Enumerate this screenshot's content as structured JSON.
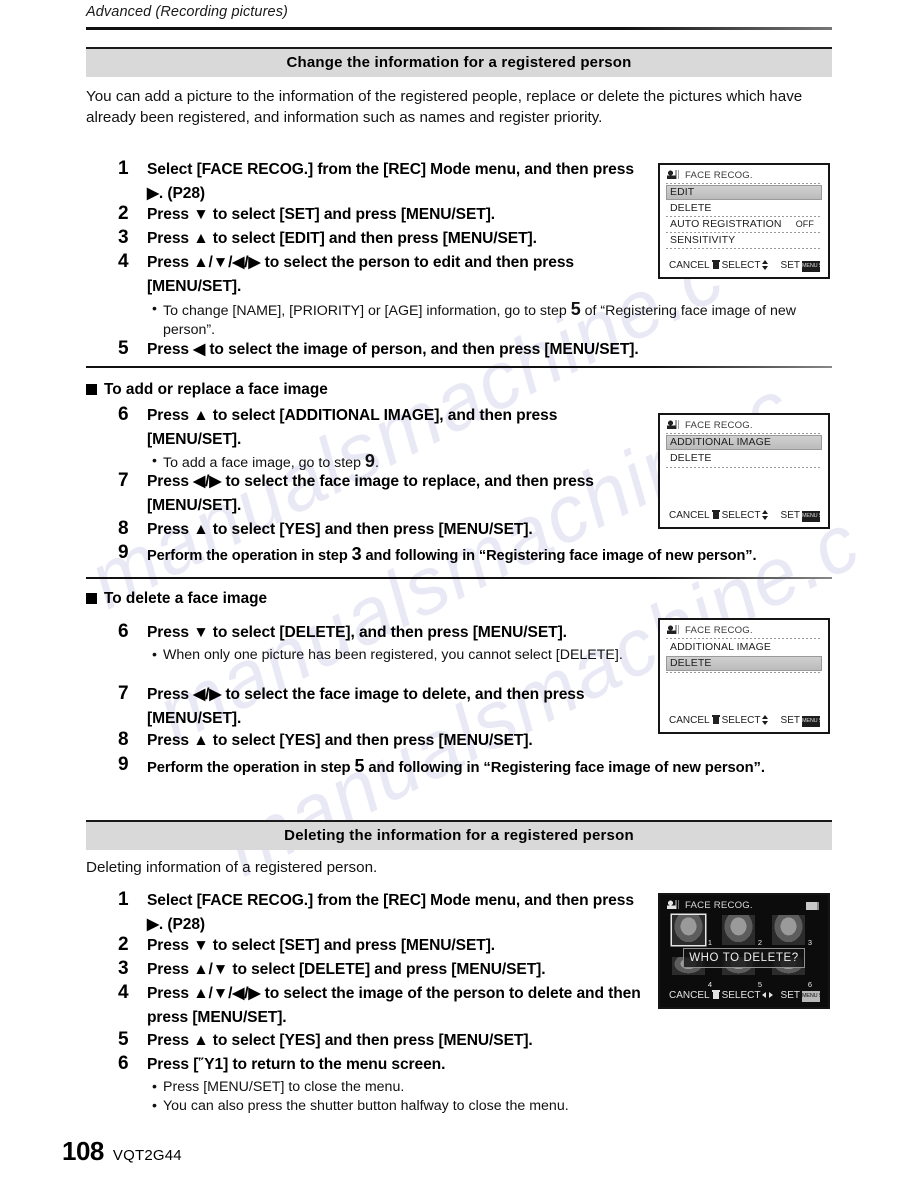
{
  "running_header": "Advanced (Recording pictures)",
  "watermark": "manualsmachine.com",
  "footer": {
    "page_number": "108",
    "doc_code": "VQT2G44"
  },
  "section1": {
    "banner_title": "Change the information for a registered person",
    "intro": "You can add a picture to the information of the registered people, replace or delete the pictures which have already been registered, and information such as names and register priority.",
    "steps": [
      {
        "num": "1",
        "text": "Select [FACE RECOG.] from the [REC] Mode menu, and then press ▶. (P28)"
      },
      {
        "num": "2",
        "text": "Press ▼ to select [SET] and press [MENU/SET]."
      },
      {
        "num": "3",
        "text": "Press ▲ to select [EDIT] and then press [MENU/SET]."
      },
      {
        "num": "4",
        "text": "Press ▲/▼/◀/▶ to select the person to edit and then press [MENU/SET]."
      }
    ],
    "bullet_after_4_a": "To change [NAME], [PRIORITY] or [AGE] information, go to step",
    "bullet_after_4_num": "5",
    "bullet_after_4_b": "of “Registering face image of new person”.",
    "step5": {
      "num": "5",
      "text": "Press ◀ to select the image of person, and then press [MENU/SET]."
    }
  },
  "subsection_add": {
    "heading": "To add or replace a face image",
    "step6": {
      "num": "6",
      "text": "Press ▲ to select [ADDITIONAL IMAGE], and then press [MENU/SET]."
    },
    "bullet6_a": "To add a face image, go to step",
    "bullet6_num": "9",
    "bullet6_b": ".",
    "step7": {
      "num": "7",
      "text": "Press ◀/▶ to select the face image to replace, and then press [MENU/SET]."
    },
    "step8": {
      "num": "8",
      "text": "Press ▲ to select [YES] and then press [MENU/SET]."
    },
    "step9": {
      "num": "9",
      "a": "Perform the operation in step",
      "step_ref": "3",
      "b": "and following in “Registering face image of new person”."
    }
  },
  "subsection_delete": {
    "heading": "To delete a face image",
    "step6": {
      "num": "6",
      "text": "Press ▼ to select [DELETE], and then press [MENU/SET]."
    },
    "bullet6": "When only one picture has been registered, you cannot select [DELETE].",
    "step7": {
      "num": "7",
      "text": "Press ◀/▶ to select the face image to delete, and then press [MENU/SET]."
    },
    "step8": {
      "num": "8",
      "text": "Press ▲ to select [YES] and then press [MENU/SET]."
    },
    "step9": {
      "num": "9",
      "a": "Perform the operation in step",
      "step_ref": "5",
      "b": "and following in “Registering face image of new person”."
    }
  },
  "section2": {
    "banner_title": "Deleting the information for a registered person",
    "intro": "Deleting information of a registered person.",
    "steps": [
      {
        "num": "1",
        "text": "Select [FACE RECOG.] from the [REC] Mode menu, and then press ▶. (P28)"
      },
      {
        "num": "2",
        "text": "Press ▼ to select [SET] and press [MENU/SET]."
      },
      {
        "num": "3",
        "text": "Press ▲/▼ to select [DELETE] and press [MENU/SET]."
      },
      {
        "num": "4",
        "text": "Press ▲/▼/◀/▶ to select the image of the person to delete and then press [MENU/SET]."
      },
      {
        "num": "5",
        "text": "Press ▲ to select [YES] and then press [MENU/SET]."
      },
      {
        "num": "6",
        "text": "Press [Ὕ1] to return to the menu screen."
      }
    ],
    "bullets": [
      "Press [MENU/SET] to close the menu.",
      "You can also press the shutter button halfway to close the menu."
    ]
  },
  "lcd1": {
    "title": "FACE RECOG.",
    "rows": [
      {
        "label": "EDIT",
        "value": "",
        "selected": true
      },
      {
        "label": "DELETE",
        "value": "",
        "selected": false
      },
      {
        "label": "AUTO REGISTRATION",
        "value": "OFF",
        "selected": false
      },
      {
        "label": "SENSITIVITY",
        "value": "",
        "selected": false
      }
    ],
    "cancel_label": "CANCEL",
    "select_label": "SELECT",
    "set_label": "SET",
    "set_button": "MENU SET"
  },
  "lcd2": {
    "title": "FACE RECOG.",
    "rows": [
      {
        "label": "ADDITIONAL IMAGE",
        "value": "",
        "selected": true
      },
      {
        "label": "DELETE",
        "value": "",
        "selected": false
      }
    ],
    "cancel_label": "CANCEL",
    "select_label": "SELECT",
    "set_label": "SET",
    "set_button": "MENU SET"
  },
  "lcd3": {
    "title": "FACE RECOG.",
    "rows": [
      {
        "label": "ADDITIONAL IMAGE",
        "value": "",
        "selected": false
      },
      {
        "label": "DELETE",
        "value": "",
        "selected": true
      }
    ],
    "cancel_label": "CANCEL",
    "select_label": "SELECT",
    "set_label": "SET",
    "set_button": "MENU SET"
  },
  "lcd4": {
    "title": "FACE RECOG.",
    "prompt": "WHO TO DELETE?",
    "faces": [
      "1",
      "2",
      "3",
      "4",
      "5",
      "6"
    ],
    "selected_face": "1",
    "cancel_label": "CANCEL",
    "select_label": "SELECT",
    "set_label": "SET",
    "set_button": "MENU SET"
  }
}
